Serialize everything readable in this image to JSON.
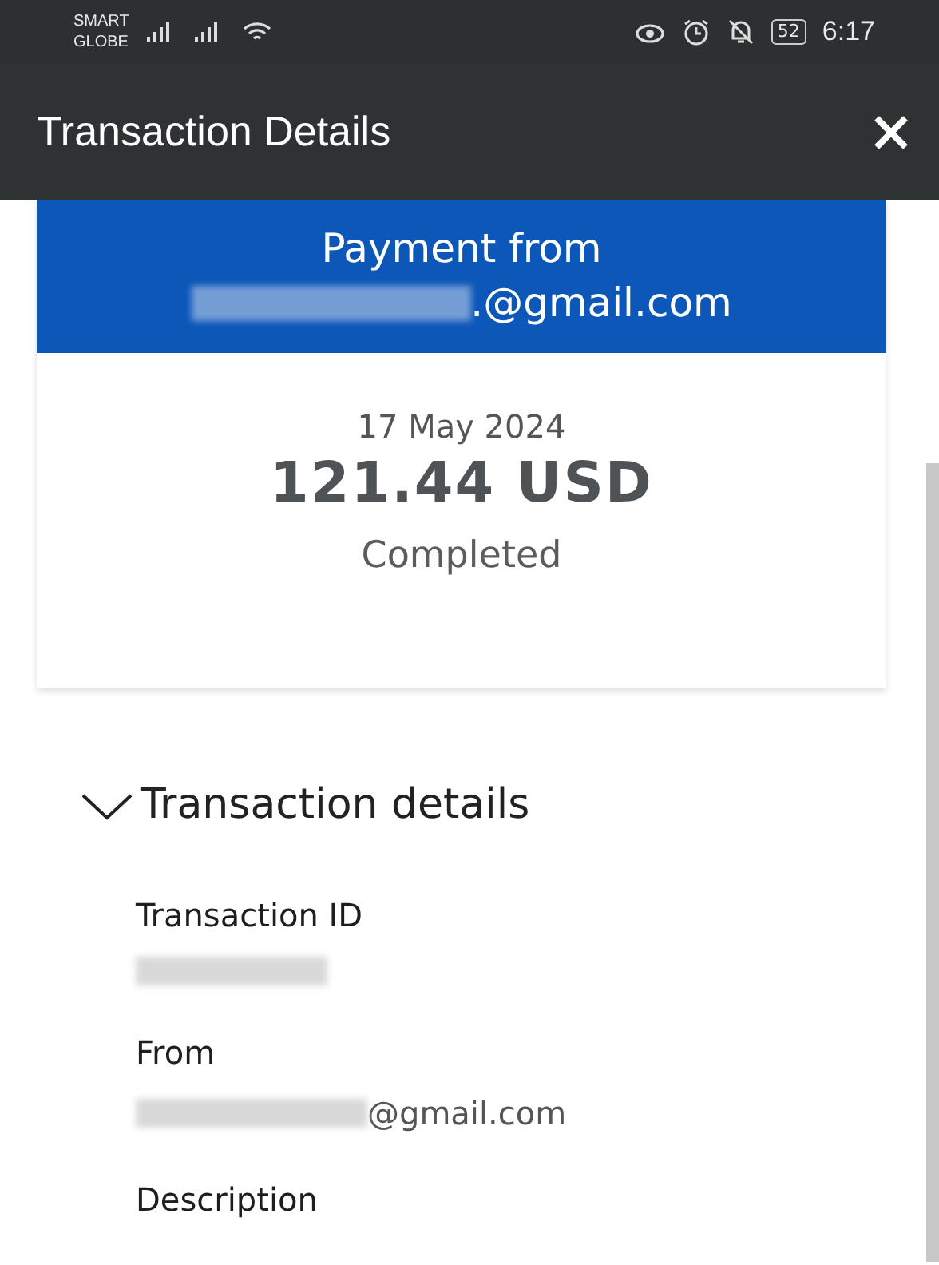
{
  "status_bar": {
    "carrier": [
      "SMART",
      "GLOBE"
    ],
    "battery": "52",
    "time": "6:17"
  },
  "header": {
    "title": "Transaction Details"
  },
  "summary": {
    "heading": "Payment from",
    "payer_email_visible": ".@gmail.com",
    "date": "17 May 2024",
    "amount": "121.44 USD",
    "status": "Completed"
  },
  "details": {
    "title": "Transaction details",
    "expanded": true,
    "fields": [
      {
        "label": "Transaction ID",
        "redacted": true
      },
      {
        "label": "From",
        "redacted": true,
        "value": "@gmail.com"
      },
      {
        "label": "Description",
        "redacted": false
      }
    ]
  }
}
